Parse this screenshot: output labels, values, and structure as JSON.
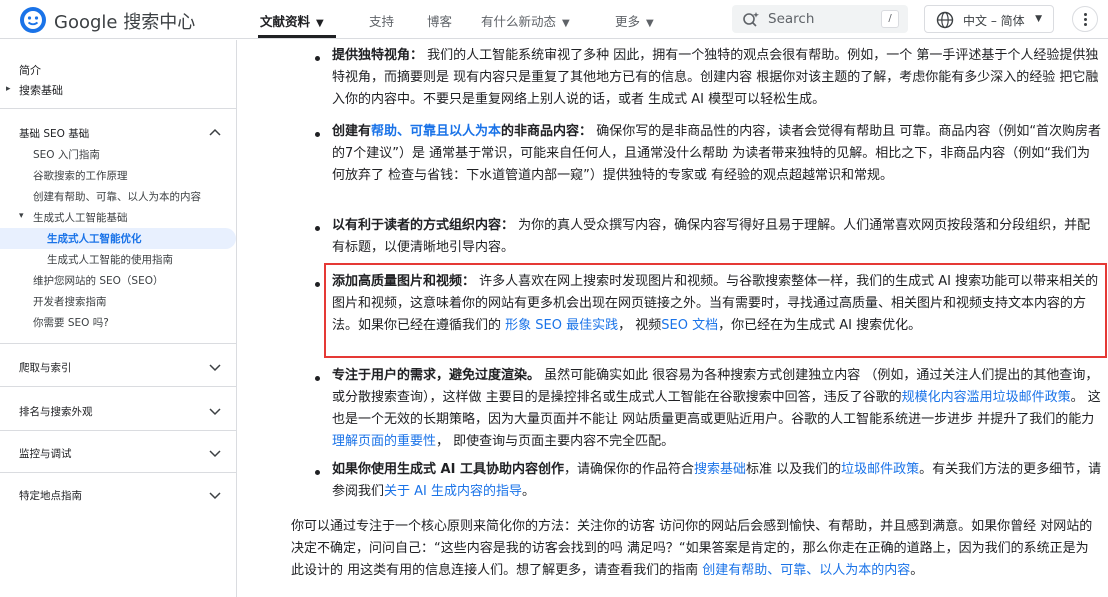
{
  "header": {
    "logo_text": "Google 搜索中心",
    "nav": [
      {
        "label": "文献资料",
        "has_menu": true,
        "active": true
      },
      {
        "label": "支持",
        "has_menu": false
      },
      {
        "label": "博客",
        "has_menu": false
      },
      {
        "label": "有什么新动态",
        "has_menu": true
      },
      {
        "label": "更多",
        "has_menu": true
      }
    ],
    "search_placeholder": "Search",
    "search_shortcut": "/",
    "language": "中文 – 简体",
    "colors": {
      "accent": "#1a73e8",
      "highlight_border": "#e53935"
    }
  },
  "sidebar": {
    "top_items": [
      "简介",
      "搜索基础"
    ],
    "section_seo_basics": {
      "title": "基础 SEO 基础",
      "items": [
        "SEO 入门指南",
        "谷歌搜索的工作原理",
        "创建有帮助、可靠、以人为本的内容",
        "生成式人工智能基础",
        "生成式人工智能优化",
        "生成式人工智能的使用指南",
        "维护您网站的 SEO（SEO）",
        "开发者搜索指南",
        "你需要 SEO 吗?"
      ],
      "selected": "生成式人工智能优化"
    },
    "collapsed_sections": [
      "爬取与索引",
      "排名与搜索外观",
      "监控与调试",
      "特定地点指南"
    ]
  },
  "content": {
    "bullets": [
      {
        "bold": "提供独特视角：",
        "text": "我们的人工智能系统审视了多种 因此，拥有一个独特的观点会很有帮助。例如，一个 第一手评述基于个人经验提供独特视角，而摘要则是 现有内容只是重复了其他地方已有的信息。创建内容 根据你对该主题的了解，考虑你能有多少深入的经验 把它融入你的内容中。不要只是重复网络上别人说的话，或者 生成式 AI 模型可以轻松生成。"
      },
      {
        "bold_prefix": "创建有",
        "link": "帮助、可靠且以人为本",
        "bold_suffix": "的非商品内容：",
        "text": "确保你写的是非商品性的内容，读者会觉得有帮助且 可靠。商品内容（例如“首次购房者的7个建议”）是 通常基于常识，可能来自任何人，且通常没什么帮助 为读者带来独特的见解。相比之下，非商品内容（例如“我们为何放弃了 检查与省钱：下水道管道内部一窥”）提供独特的专家或 有经验的观点超越常识和常规。"
      },
      {
        "bold": "以有利于读者的方式组织内容：",
        "text": "为你的真人受众撰写内容，确保内容写得好且易于理解。人们通常喜欢网页按段落和分段组织，并配有标题，以便清晰地引导内容。"
      },
      {
        "bold": "添加高质量图片和视频：",
        "text": "许多人喜欢在网上搜索时发现图片和视频。与谷歌搜索整体一样，我们的生成式 AI 搜索功能可以带来相关的图片和视频，这意味着你的网站有更多机会出现在网页链接之外。当有需要时，寻找通过高质量、相关图片和视频支持文本内容的方法。如果你已经在遵循我们的",
        "link1": "形象 SEO 最佳实践",
        "mid": "，  视频",
        "link2": "SEO 文档",
        "tail": "，你已经在为生成式 AI 搜索优化。"
      },
      {
        "bold": "专注于用户的需求，避免过度渲染。",
        "text": "虽然可能确实如此 很容易为各种搜索方式创建独立内容 （例如，通过关注人们提出的其他查询，或分散搜索查询），这样做 主要目的是操控排名或生成式人工智能在谷歌搜索中回答，违反了谷歌的",
        "link1": "规模化内容滥用垃圾邮件政策",
        "mid": "。 这也是一个无效的长期策略，因为大量页面并不能让 网站质量更高或更贴近用户。谷歌的人工智能系统进一步进步 并提升了我们的能力",
        "link2": "理解页面的重要性",
        "tail": "， 即使查询与页面主要内容不完全匹配。"
      },
      {
        "bold": "如果你使用生成式 AI 工具协助内容创作",
        "text": "，请确保你的作品符合",
        "link1": "搜索基础",
        "mid": "标准 以及我们的",
        "link2": "垃圾邮件政策",
        "mid2": "。有关我们方法的更多细节，请参阅我们",
        "link3": "关于 AI 生成内容的指导",
        "tail": "。"
      }
    ],
    "closing": {
      "text": "你可以通过专注于一个核心原则来简化你的方法：关注你的访客 访问你的网站后会感到愉快、有帮助，并且感到满意。如果你曾经 对网站的决定不确定，问问自己：“这些内容是我的访客会找到的吗 满足吗？“如果答案是肯定的，那么你走在正确的道路上，因为我们的系统正是为此设计的 用这类有用的信息连接人们。想了解更多，请查看我们的指南",
      "link": "创建有帮助、可靠、以人为本的内容",
      "tail": "。"
    }
  }
}
